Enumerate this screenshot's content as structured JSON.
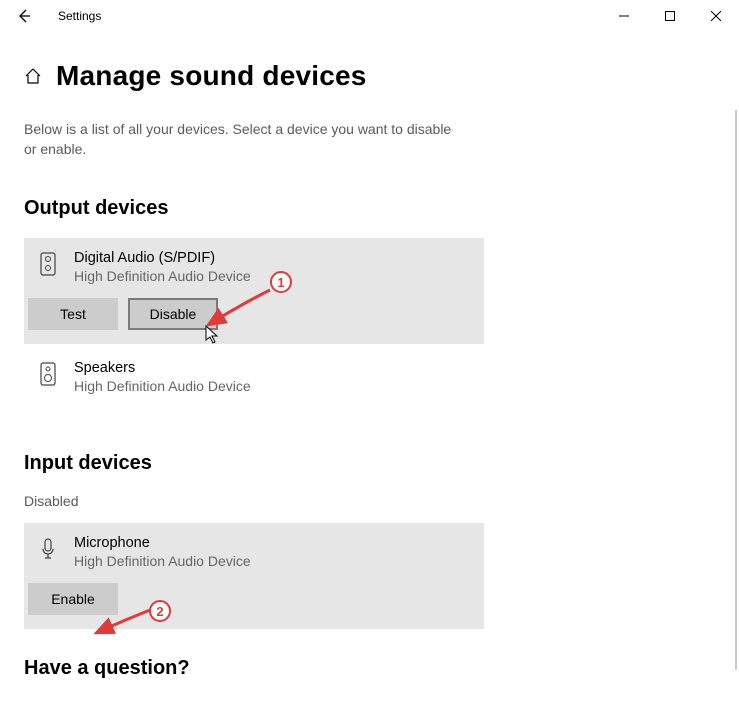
{
  "window": {
    "title": "Settings"
  },
  "page": {
    "title": "Manage sound devices",
    "description": "Below is a list of all your devices. Select a device you want to disable or enable."
  },
  "sections": {
    "output_title": "Output devices",
    "input_title": "Input devices",
    "disabled_label": "Disabled",
    "question_title": "Have a question?"
  },
  "output_devices": [
    {
      "name": "Digital Audio (S/PDIF)",
      "sub": "High Definition Audio Device",
      "selected": true,
      "buttons": {
        "test": "Test",
        "disable": "Disable"
      }
    },
    {
      "name": "Speakers",
      "sub": "High Definition Audio Device",
      "selected": false
    }
  ],
  "input_devices": [
    {
      "name": "Microphone",
      "sub": "High Definition Audio Device",
      "selected": true,
      "buttons": {
        "enable": "Enable"
      }
    }
  ],
  "annotations": {
    "step1": "1",
    "step2": "2"
  }
}
